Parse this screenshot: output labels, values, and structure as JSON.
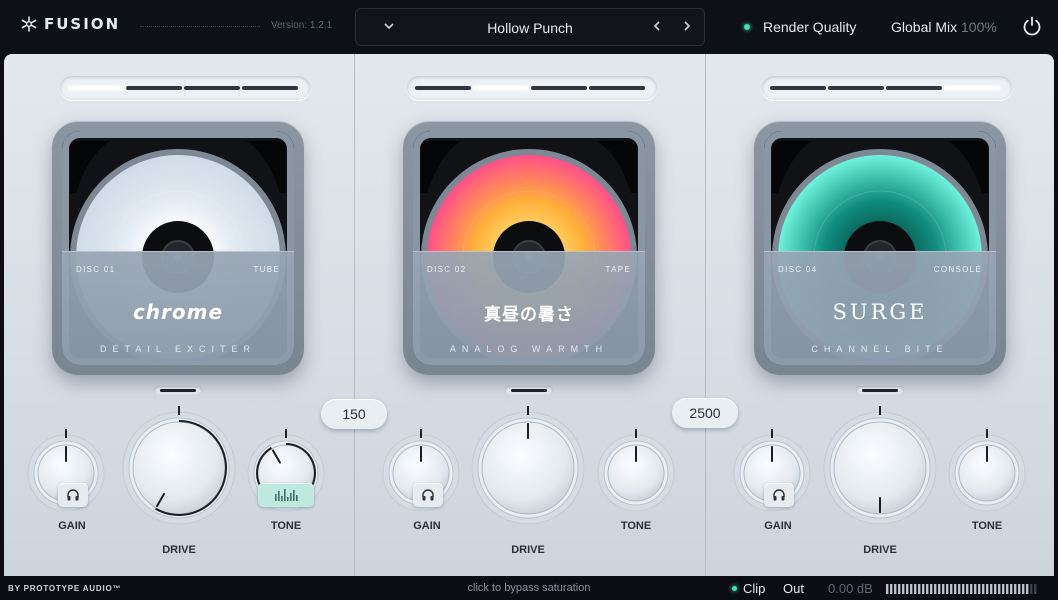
{
  "header": {
    "app_name": "FUSION",
    "version": "Version: 1.2.1",
    "preset": "Hollow Punch",
    "render_quality_label": "Render Quality",
    "global_mix_label": "Global Mix",
    "global_mix_value": "100%"
  },
  "slots": [
    {
      "disc_number": "DISC 01",
      "disc_type": "TUBE",
      "title": "chrome",
      "subtitle": "DETAIL EXCITER",
      "active_segment": 1,
      "gain_label": "GAIN",
      "drive_label": "DRIVE",
      "tone_label": "TONE"
    },
    {
      "disc_number": "DISC 02",
      "disc_type": "TAPE",
      "title": "真昼の暑さ",
      "subtitle": "ANALOG WARMTH",
      "active_segment": 2,
      "gain_label": "GAIN",
      "drive_label": "DRIVE",
      "tone_label": "TONE"
    },
    {
      "disc_number": "DISC 04",
      "disc_type": "CONSOLE",
      "title": "SURGE",
      "subtitle": "CHANNEL BITE",
      "active_segment": 4,
      "gain_label": "GAIN",
      "drive_label": "DRIVE",
      "tone_label": "TONE"
    }
  ],
  "crossovers": {
    "low_mid": "150",
    "mid_high": "2500"
  },
  "footer": {
    "brand": "BY PROTOTYPE AUDIO™",
    "hint": "click to bypass saturation",
    "clip_label": "Clip",
    "out_label": "Out",
    "out_value": "0.00 dB"
  },
  "colors": {
    "accent": "#3ee0b5",
    "disc_chrome": "#d9e4ee",
    "disc_warm_outer": "#ff4f8a",
    "disc_warm_inner": "#ffb03a",
    "disc_surge_outer": "#6ff2dc",
    "disc_surge_inner": "#0f8c7e"
  },
  "icons": {
    "logo": "asterisk-logo-icon",
    "preset_menu": "chevron-down-icon",
    "preset_prev": "chevron-left-icon",
    "preset_next": "chevron-right-icon",
    "power": "power-icon",
    "solo": "headphones-icon",
    "tone_mode": "eq-bars-icon"
  }
}
